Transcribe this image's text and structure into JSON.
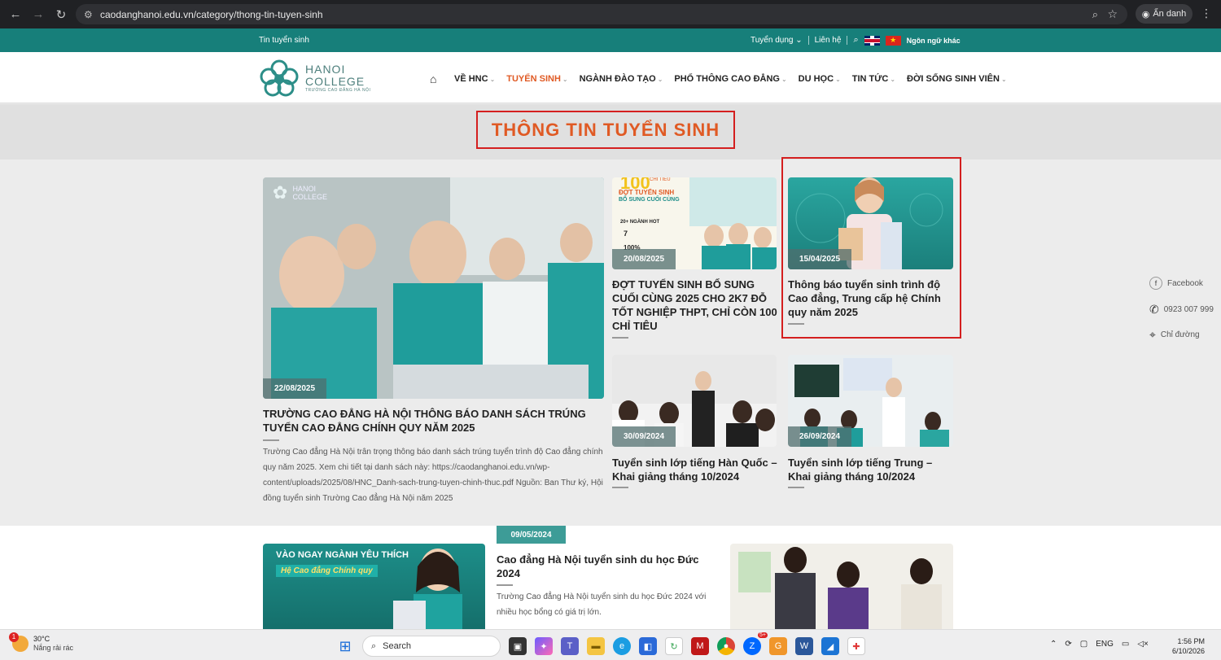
{
  "browser": {
    "url": "caodanghanoi.edu.vn/category/thong-tin-tuyen-sinh",
    "incognito_label": "Ẩn danh"
  },
  "topbar": {
    "left_link": "Tin tuyển sinh",
    "recruit": "Tuyển dụng",
    "contact": "Liên hệ",
    "lang_label": "Ngôn ngữ khác"
  },
  "logo": {
    "line1": "HANOI",
    "line2": "COLLEGE",
    "line3": "TRƯỜNG CAO ĐẲNG HÀ NỘI"
  },
  "nav": {
    "items": [
      {
        "label": "VỀ HNC"
      },
      {
        "label": "TUYỂN SINH"
      },
      {
        "label": "NGÀNH ĐÀO TẠO"
      },
      {
        "label": "PHỔ THÔNG CAO ĐẲNG"
      },
      {
        "label": "DU HỌC"
      },
      {
        "label": "TIN TỨC"
      },
      {
        "label": "ĐỜI SỐNG SINH VIÊN"
      }
    ]
  },
  "page_title": "THÔNG TIN TUYỂN SINH",
  "posts": {
    "featured": {
      "date": "22/08/2025",
      "title": "TRƯỜNG CAO ĐẲNG HÀ NỘI THÔNG BÁO DANH SÁCH TRÚNG TUYỂN CAO ĐẲNG CHÍNH QUY NĂM 2025",
      "excerpt": "Trường Cao đẳng Hà Nội trân trọng thông báo danh sách trúng tuyển trình độ Cao đẳng chính quy năm 2025. Xem chi tiết tại danh sách này: https://caodanghanoi.edu.vn/wp-content/uploads/2025/08/HNC_Danh-sach-trung-tuyen-chinh-thuc.pdf Nguồn: Ban Thư ký, Hội đồng tuyển sinh Trường Cao đẳng Hà Nội năm 2025",
      "img_logo1": "HANOI",
      "img_logo2": "COLLEGE"
    },
    "p2": {
      "date": "20/08/2025",
      "title": "ĐỢT TUYỂN SINH BỔ SUNG CUỐI CÙNG 2025 CHO 2K7 ĐỖ TỐT NGHIỆP THPT, CHỈ CÒN 100 CHỈ TIÊU",
      "img_top": "100",
      "img_sub": "CHỈ TIÊU",
      "img_line1": "ĐỢT TUYỂN SINH",
      "img_line2": "BỔ SUNG CUỐI CÙNG",
      "img_b1": "20+ NGÀNH HOT",
      "img_b2": "7",
      "img_b3": "100%"
    },
    "p3": {
      "date": "15/04/2025",
      "title": "Thông báo tuyển sinh trình độ Cao đẳng, Trung cấp hệ Chính quy năm 2025"
    },
    "p4": {
      "date": "30/09/2024",
      "title": "Tuyển sinh lớp tiếng Hàn Quốc – Khai giảng tháng 10/2024"
    },
    "p5": {
      "date": "26/09/2024",
      "title": "Tuyển sinh lớp tiếng Trung – Khai giảng tháng 10/2024"
    }
  },
  "lower": {
    "img_text1": "VÀO NGAY NGÀNH YÊU THÍCH",
    "img_text2": "Hệ Cao đẳng Chính quy",
    "date": "09/05/2024",
    "title": "Cao đẳng Hà Nội tuyển sinh du học Đức 2024",
    "excerpt": "Trường Cao đẳng Hà Nội tuyển sinh du học Đức 2024 với nhiều học bổng có giá trị lớn."
  },
  "side": {
    "facebook": "Facebook",
    "phone": "0923 007 999",
    "directions": "Chỉ đường"
  },
  "taskbar": {
    "temp": "30°C",
    "condition": "Nắng rải rác",
    "weather_badge": "1",
    "search": "Search",
    "lang": "ENG",
    "time": "1:56 PM",
    "date": "6/10/2026",
    "notif_badge": "5+"
  }
}
